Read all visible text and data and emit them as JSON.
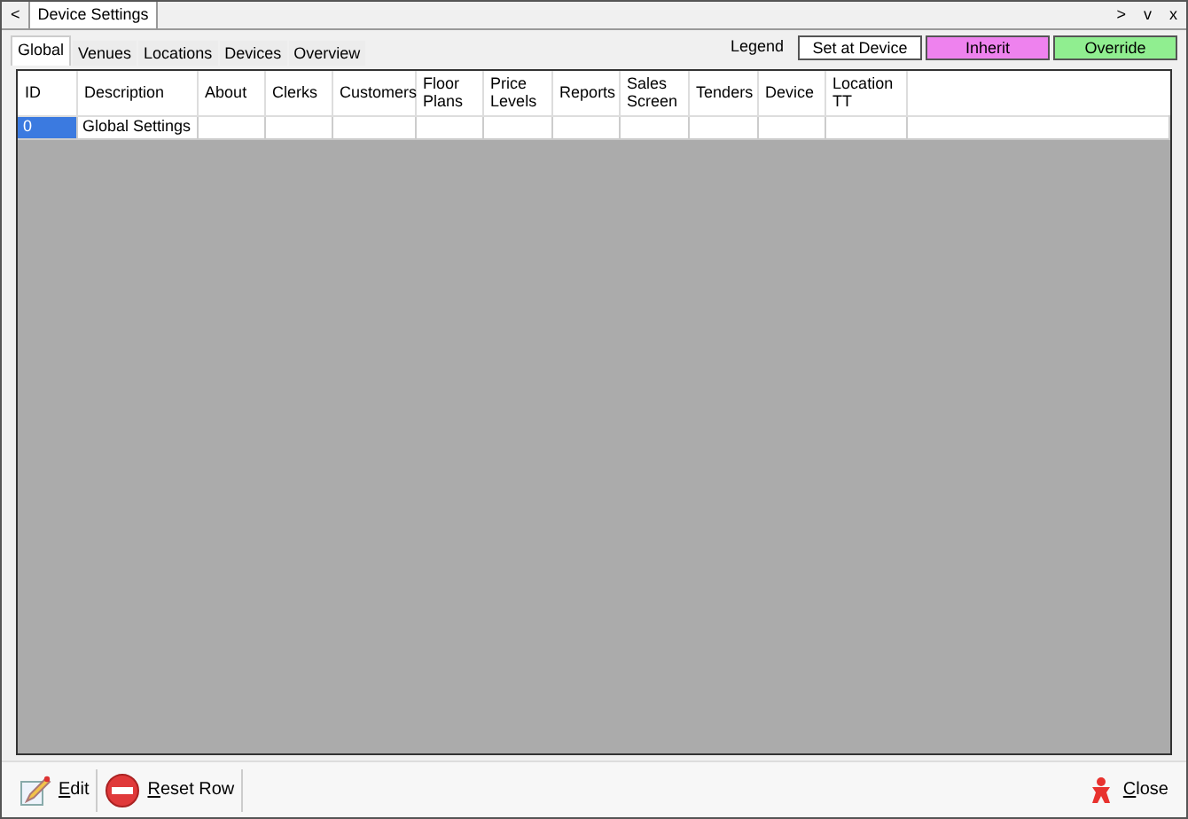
{
  "doc_tabs": {
    "prev": "<",
    "tabs": [
      {
        "label": "Device Settings",
        "selected": true
      }
    ],
    "next": ">",
    "menu": "v",
    "close": "x"
  },
  "tabs": [
    {
      "label": "Global",
      "selected": true
    },
    {
      "label": "Venues",
      "selected": false
    },
    {
      "label": "Locations",
      "selected": false
    },
    {
      "label": "Devices",
      "selected": false
    },
    {
      "label": "Overview",
      "selected": false
    }
  ],
  "legend": {
    "label": "Legend",
    "items": [
      {
        "label": "Set at Device",
        "color": "#ffffff"
      },
      {
        "label": "Inherit",
        "color": "#ee82ee"
      },
      {
        "label": "Override",
        "color": "#90ee90"
      }
    ]
  },
  "table": {
    "columns": [
      "ID",
      "Description",
      "About",
      "Clerks",
      "Customers",
      "Floor Plans",
      "Price Levels",
      "Reports",
      "Sales Screen",
      "Tenders",
      "Device",
      "Location TT"
    ],
    "rows": [
      {
        "cells": [
          "0",
          "Global Settings",
          "",
          "",
          "",
          "",
          "",
          "",
          "",
          "",
          "",
          ""
        ],
        "selected": true
      }
    ]
  },
  "toolbar": [
    {
      "kind": "edit",
      "label": "Edit",
      "mnemonic": true
    },
    {
      "kind": "reset",
      "label": "Reset Row",
      "mnemonic": true
    },
    {
      "kind": "close",
      "label": "Close",
      "mnemonic": true
    }
  ]
}
